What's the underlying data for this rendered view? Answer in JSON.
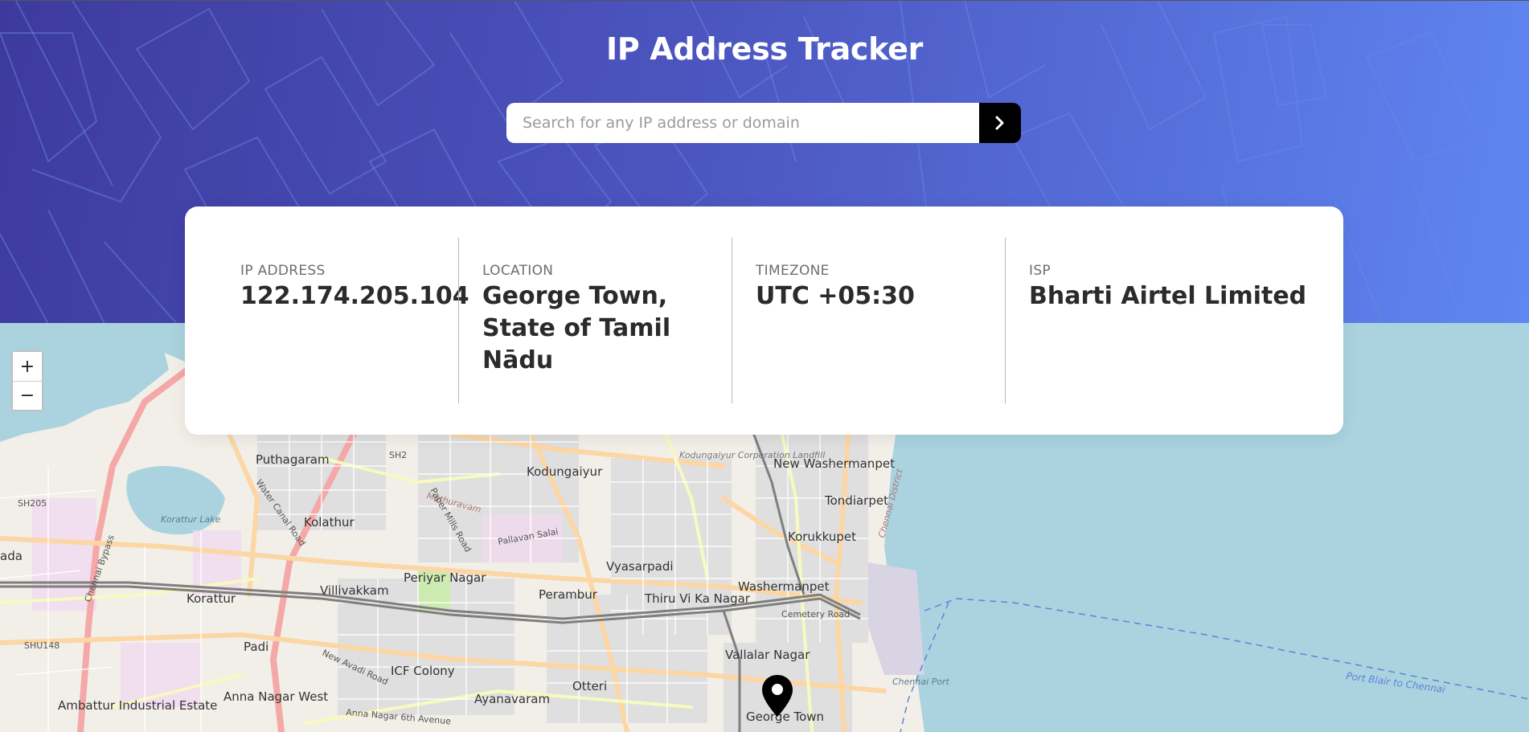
{
  "header": {
    "title": "IP Address Tracker",
    "search_placeholder": "Search for any IP address or domain",
    "search_value": ""
  },
  "info": {
    "ip": {
      "label": "IP ADDRESS",
      "value": "122.174.205.104"
    },
    "location": {
      "label": "LOCATION",
      "value": "George Town, State of Tamil Nādu"
    },
    "timezone": {
      "label": "TIMEZONE",
      "value": "UTC +05:30"
    },
    "isp": {
      "label": "ISP",
      "value": "Bharti Airtel Limited"
    }
  },
  "map": {
    "zoom_in": "+",
    "zoom_out": "−",
    "labels": [
      "Puthagaram",
      "SH2",
      "Kodungaiyur",
      "Kodungaiyur Corporation Landfill",
      "New Washermanpet",
      "Tondiarpet",
      "Korukkupet",
      "SH205",
      "Kolathur",
      "Korattur Lake",
      "ada",
      "Vyasarpadi",
      "Periyar Nagar",
      "Perambur",
      "Villivakkam",
      "Korattur",
      "Thiru Vi Ka Nagar",
      "Washermanpet",
      "Cemetery Road",
      "SHU148",
      "Padi",
      "ICF Colony",
      "Vallalar Nagar",
      "Anna Nagar West",
      "Ayanavaram",
      "Otteri",
      "Ambattur Industrial Estate",
      "George Town",
      "Chennai Port",
      "Port Blair to Chennai",
      "Chennai District",
      "Mathuravam",
      "Chennai Bypass",
      "New Avadi Road",
      "Anna Nagar 6th Avenue",
      "Pallavan Salai",
      "Water Canal Road",
      "Paper Mills Road"
    ]
  },
  "colors": {
    "header_start": "#3d3a9e",
    "header_end": "#5f86f2",
    "sea": "#aad3df",
    "land": "#f2efe9",
    "value_text": "#2b2b2b",
    "label_text": "#6e6e6e"
  }
}
